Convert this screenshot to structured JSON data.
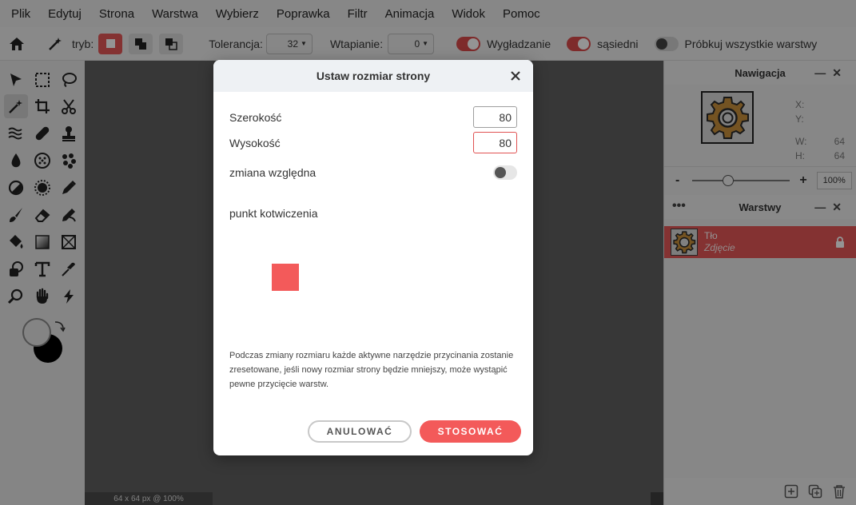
{
  "menu": [
    "Plik",
    "Edytuj",
    "Strona",
    "Warstwa",
    "Wybierz",
    "Poprawka",
    "Filtr",
    "Animacja",
    "Widok",
    "Pomoc"
  ],
  "options": {
    "mode_label": "tryb:",
    "tolerance_label": "Tolerancja:",
    "tolerance_value": "32",
    "feather_label": "Wtapianie:",
    "feather_value": "0",
    "smoothing_label": "Wygładzanie",
    "contiguous_label": "sąsiedni",
    "sample_all_label": "Próbkuj wszystkie warstwy"
  },
  "navigation": {
    "title": "Nawigacja",
    "x_label": "X:",
    "y_label": "Y:",
    "w_label": "W:",
    "w_value": "64",
    "h_label": "H:",
    "h_value": "64",
    "zoom_minus": "-",
    "zoom_plus": "+",
    "zoom_value": "100%"
  },
  "layers": {
    "title": "Warstwy",
    "items": [
      {
        "name": "Tło",
        "type": "Zdjęcie"
      }
    ]
  },
  "status_text": "64 x 64 px @ 100%",
  "dialog": {
    "title": "Ustaw rozmiar strony",
    "width_label": "Szerokość",
    "width_value": "80",
    "height_label": "Wysokość",
    "height_value": "80",
    "relative_label": "zmiana względna",
    "anchor_label": "punkt kotwiczenia",
    "info": "Podczas zmiany rozmiaru każde aktywne narzędzie przycinania zostanie zresetowane, jeśli nowy rozmiar strony będzie mniejszy, może wystąpić pewne przycięcie warstw.",
    "cancel_label": "ANULOWAĆ",
    "apply_label": "STOSOWAĆ"
  },
  "colors": {
    "accent": "#f35a5a",
    "layer_selected": "#e45757"
  }
}
